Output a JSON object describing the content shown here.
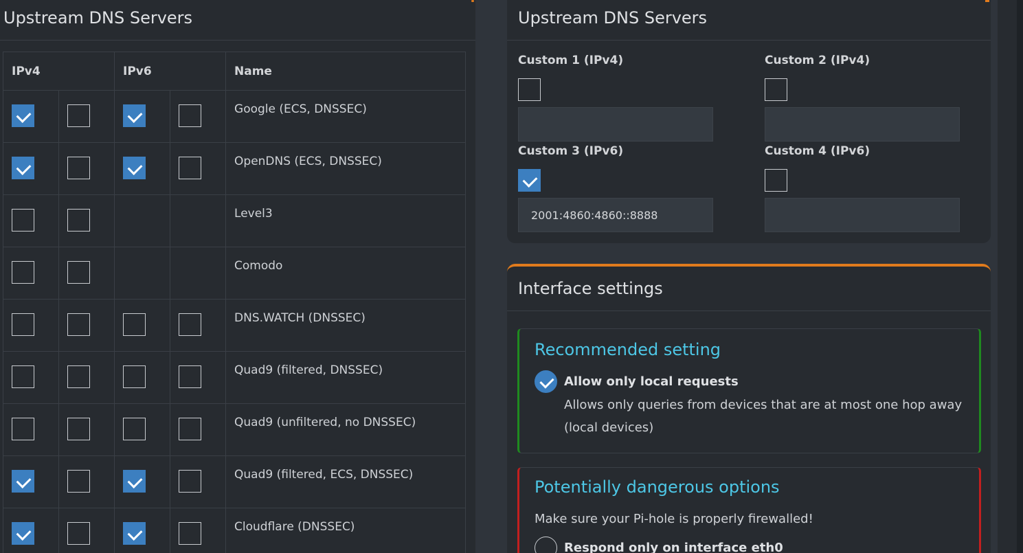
{
  "left_panel": {
    "title": "Upstream DNS Servers",
    "columns": {
      "ipv4": "IPv4",
      "ipv6": "IPv6",
      "name": "Name"
    },
    "rows": [
      {
        "name": "Google (ECS, DNSSEC)",
        "checks": [
          true,
          false,
          true,
          false
        ],
        "has_ipv6": true
      },
      {
        "name": "OpenDNS (ECS, DNSSEC)",
        "checks": [
          true,
          false,
          true,
          false
        ],
        "has_ipv6": true
      },
      {
        "name": "Level3",
        "checks": [
          false,
          false
        ],
        "has_ipv6": false
      },
      {
        "name": "Comodo",
        "checks": [
          false,
          false
        ],
        "has_ipv6": false
      },
      {
        "name": "DNS.WATCH (DNSSEC)",
        "checks": [
          false,
          false,
          false,
          false
        ],
        "has_ipv6": true
      },
      {
        "name": "Quad9 (filtered, DNSSEC)",
        "checks": [
          false,
          false,
          false,
          false
        ],
        "has_ipv6": true
      },
      {
        "name": "Quad9 (unfiltered, no DNSSEC)",
        "checks": [
          false,
          false,
          false,
          false
        ],
        "has_ipv6": true
      },
      {
        "name": "Quad9 (filtered, ECS, DNSSEC)",
        "checks": [
          true,
          false,
          true,
          false
        ],
        "has_ipv6": true
      },
      {
        "name": "Cloudflare (DNSSEC)",
        "checks": [
          true,
          false,
          true,
          false
        ],
        "has_ipv6": true
      }
    ]
  },
  "custom_panel": {
    "title": "Upstream DNS Servers",
    "custom1": {
      "label": "Custom 1 (IPv4)",
      "checked": false,
      "value": ""
    },
    "custom2": {
      "label": "Custom 2 (IPv4)",
      "checked": false,
      "value": ""
    },
    "custom3": {
      "label": "Custom 3 (IPv6)",
      "checked": true,
      "value": "2001:4860:4860::8888"
    },
    "custom4": {
      "label": "Custom 4 (IPv6)",
      "checked": false,
      "value": ""
    }
  },
  "interface_panel": {
    "title": "Interface settings",
    "recommended": {
      "heading": "Recommended setting",
      "option_label": "Allow only local requests",
      "option_desc": "Allows only queries from devices that are at most one hop away (local devices)",
      "selected": true
    },
    "dangerous": {
      "heading": "Potentially dangerous options",
      "warning": "Make sure your Pi-hole is properly firewalled!",
      "option_label": "Respond only on interface eth0",
      "selected": false
    }
  },
  "colors": {
    "accent_orange": "#e07b1d",
    "checkbox_blue": "#3c7fc0",
    "heading_cyan": "#4dc7e6",
    "recommended_green": "#1f8a1f",
    "danger_red": "#c21f1f"
  }
}
